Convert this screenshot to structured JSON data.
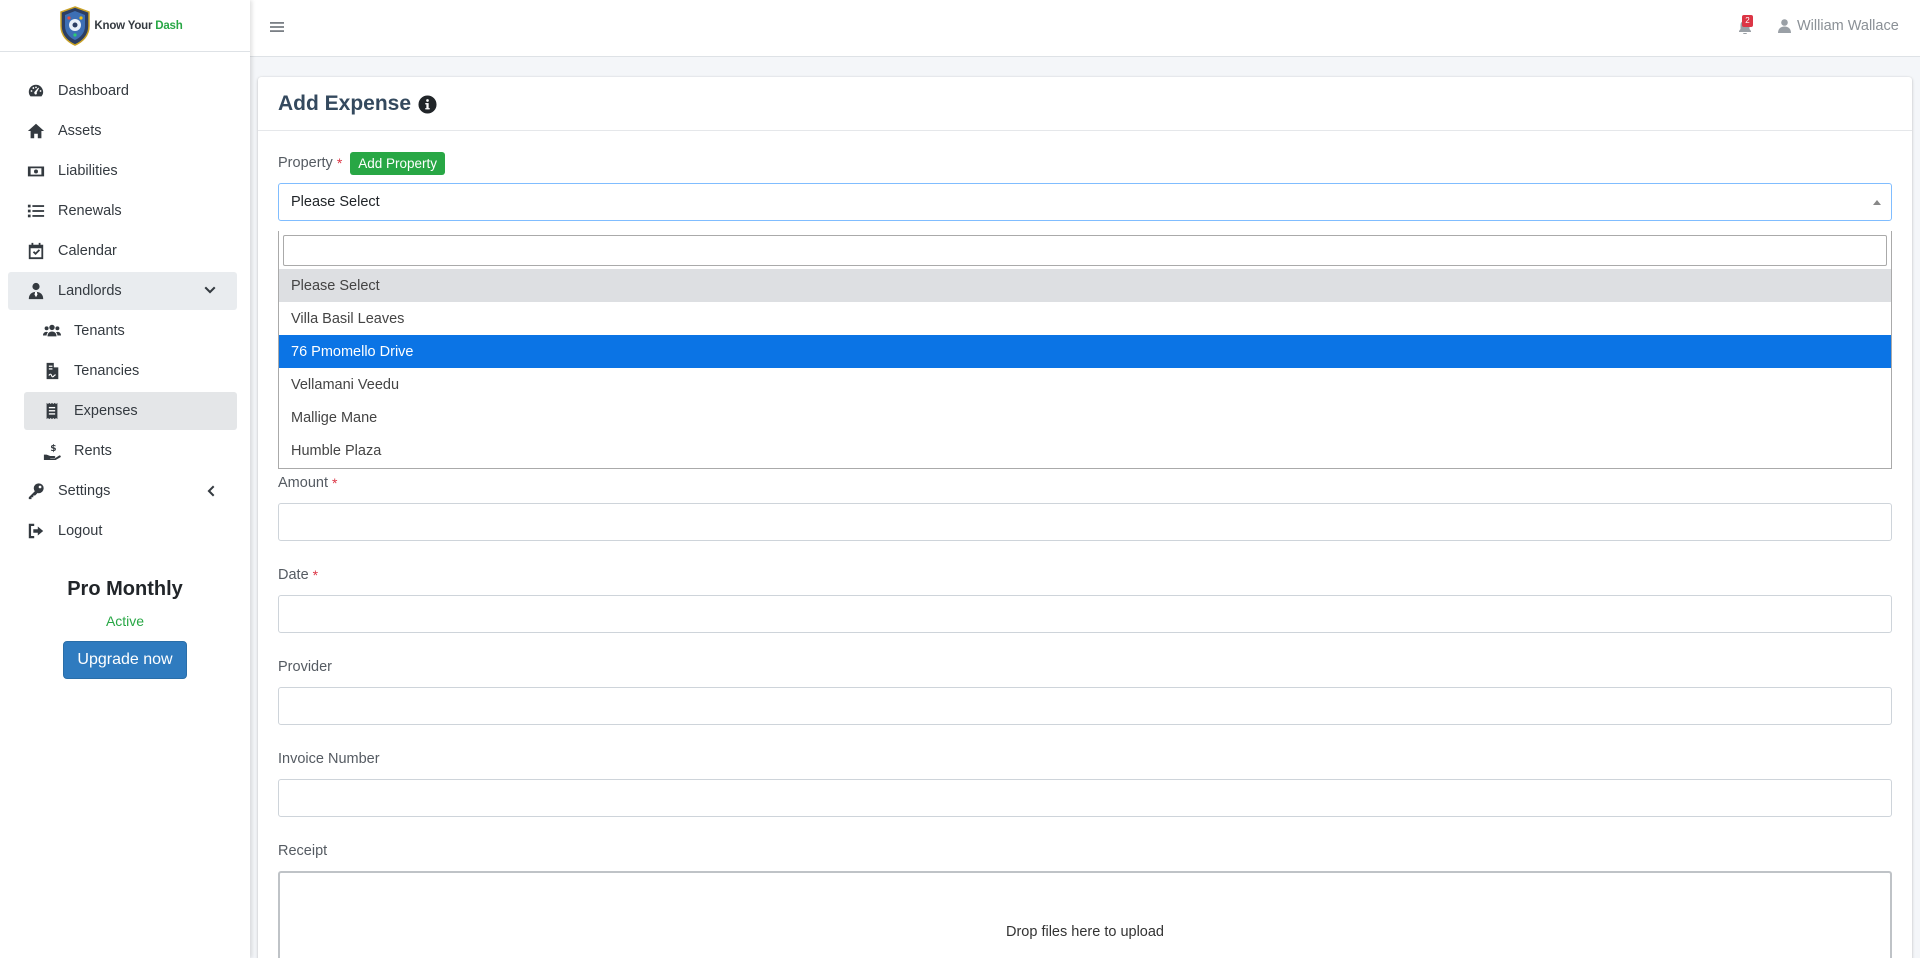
{
  "brand": {
    "name_prefix": "Know Your ",
    "name_accent": "Dash"
  },
  "sidebar": {
    "items": [
      {
        "label": "Dashboard",
        "icon": "dashboard-icon"
      },
      {
        "label": "Assets",
        "icon": "home-icon"
      },
      {
        "label": "Liabilities",
        "icon": "money-bill-icon"
      },
      {
        "label": "Renewals",
        "icon": "list-icon"
      },
      {
        "label": "Calendar",
        "icon": "calendar-check-icon"
      },
      {
        "label": "Landlords",
        "icon": "user-tie-icon",
        "expanded": true
      },
      {
        "label": "Tenants",
        "icon": "users-icon"
      },
      {
        "label": "Tenancies",
        "icon": "file-contract-icon"
      },
      {
        "label": "Expenses",
        "icon": "receipt-icon",
        "active": true
      },
      {
        "label": "Rents",
        "icon": "hand-holding-dollar-icon"
      },
      {
        "label": "Settings",
        "icon": "key-icon"
      },
      {
        "label": "Logout",
        "icon": "sign-out-icon"
      }
    ]
  },
  "plan": {
    "name": "Pro Monthly",
    "status": "Active",
    "upgrade_label": "Upgrade now"
  },
  "topbar": {
    "notification_count": "2",
    "user_name": "William Wallace"
  },
  "page": {
    "title": "Add Expense",
    "property_label": "Property",
    "required_mark": "*",
    "add_property_label": "Add Property",
    "property_selected": "Please Select",
    "property_options": [
      "Please Select",
      "Villa Basil Leaves",
      "76 Pmomello Drive",
      "Vellamani Veedu",
      "Mallige Mane",
      "Humble Plaza"
    ],
    "amount_label": "Amount",
    "date_label": "Date",
    "provider_label": "Provider",
    "invoice_label": "Invoice Number",
    "receipt_label": "Receipt",
    "dropzone_text": "Drop files here to upload"
  },
  "colors": {
    "accent_green": "#28a745",
    "primary_blue": "#2f7bbf",
    "highlight_blue": "#0b74e5",
    "required_red": "#dc3545"
  }
}
